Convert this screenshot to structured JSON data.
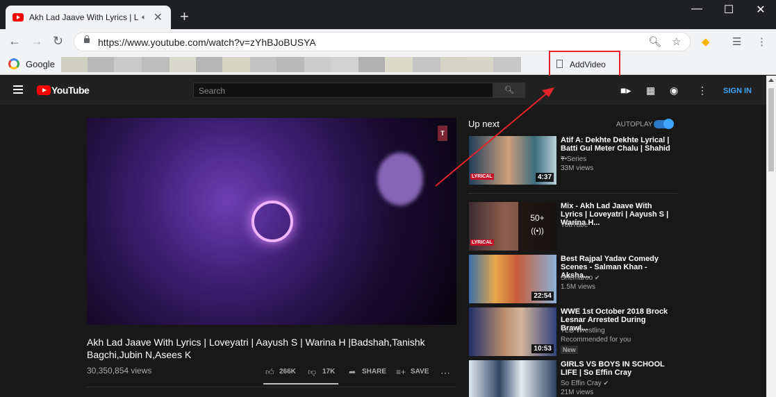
{
  "browser": {
    "tab_title": "Akh Lad Jaave With Lyrics | L",
    "url": "https://www.youtube.com/watch?v=zYhBJoBUSYA",
    "bookmarks": [
      {
        "label": "Google"
      },
      {
        "label": "AddVideo"
      }
    ]
  },
  "youtube": {
    "logo_text": "YouTube",
    "search_placeholder": "Search",
    "signin_label": "SIGN IN",
    "video": {
      "title": "Akh Lad Jaave With Lyrics | Loveyatri | Aayush S | Warina H |Badshah,Tanishk Bagchi,Jubin N,Asees K",
      "views": "30,350,854 views",
      "likes": "266K",
      "dislikes": "17K",
      "share_label": "SHARE",
      "save_label": "SAVE",
      "like_ratio": 1.0
    },
    "sidebar": {
      "up_next_label": "Up next",
      "autoplay_label": "AUTOPLAY",
      "autoplay_on": true,
      "items": [
        {
          "title": "Atif A: Dekhte Dekhte Lyrical | Batti Gul Meter Chalu | Shahid ...",
          "channel": "T-Series",
          "views": "33M views",
          "duration": "4:37",
          "thumb_tag": "LYRICAL"
        },
        {
          "title": "Mix - Akh Lad Jaave With Lyrics | Loveyatri | Aayush S | Warina H...",
          "channel": "YouTube",
          "mix_count": "50+",
          "thumb_tag": "LYRICAL"
        },
        {
          "title": "Best Rajpal Yadav Comedy Scenes - Salman Khan - Aksha...",
          "channel": "Shemaroo",
          "views": "1.5M views",
          "duration": "22:54"
        },
        {
          "title": "WWE 1st October 2018 Brock Lesnar Arrested During Brawl...",
          "channel": "TLG Wrestling",
          "views": "Recommended for you",
          "badge": "New",
          "duration": "10:53"
        },
        {
          "title": "GIRLS VS BOYS IN SCHOOL LIFE | So Effin Cray",
          "channel": "So Effin Cray",
          "views": "21M views"
        }
      ]
    }
  },
  "colors": {
    "yt_red": "#ff0000",
    "bg_dark": "#181818",
    "header_dark": "#212121",
    "link_blue": "#3ea6ff",
    "annotation_red": "#e3242b"
  }
}
